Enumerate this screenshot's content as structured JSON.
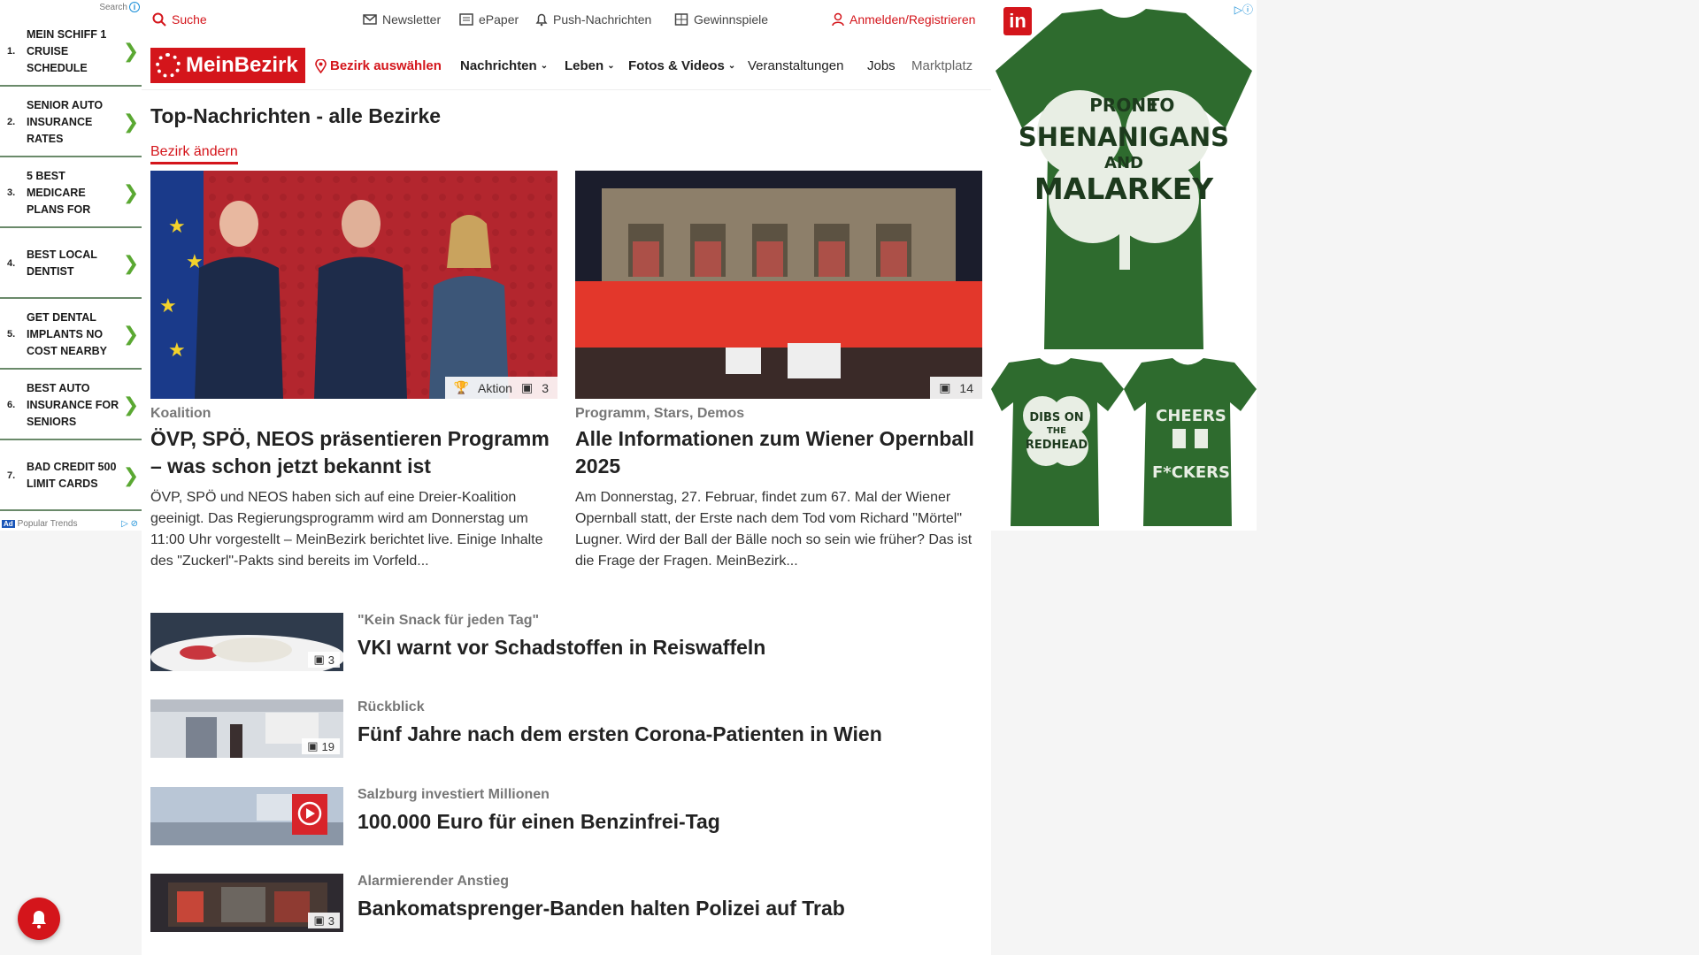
{
  "left_ad": {
    "search_label": "Search",
    "items": [
      {
        "num": "1.",
        "text": "MEIN SCHIFF 1 CRUISE SCHEDULE"
      },
      {
        "num": "2.",
        "text": "SENIOR AUTO INSURANCE RATES"
      },
      {
        "num": "3.",
        "text": "5 BEST MEDICARE PLANS FOR"
      },
      {
        "num": "4.",
        "text": "BEST LOCAL DENTIST"
      },
      {
        "num": "5.",
        "text": "GET DENTAL IMPLANTS NO COST NEARBY"
      },
      {
        "num": "6.",
        "text": "BEST AUTO INSURANCE FOR SENIORS"
      },
      {
        "num": "7.",
        "text": "BAD CREDIT 500 LIMIT CARDS"
      }
    ],
    "footer": "Popular Trends",
    "badge": "Ad"
  },
  "topbar": {
    "search": "Suche",
    "newsletter": "Newsletter",
    "epaper": "ePaper",
    "push": "Push-Nachrichten",
    "gewinnspiele": "Gewinnspiele",
    "login": "Anmelden/Registrieren"
  },
  "nav": {
    "logo": "MeinBezirk",
    "bezirk": "Bezirk auswählen",
    "items": [
      "Nachrichten",
      "Leben",
      "Fotos & Videos",
      "Veranstaltungen",
      "Jobs",
      "Marktplatz"
    ]
  },
  "page": {
    "title": "Top-Nachrichten - alle Bezirke",
    "change_link": "Bezirk ändern"
  },
  "cards": [
    {
      "kicker": "Koalition",
      "title": "ÖVP, SPÖ, NEOS präsentieren Programm – was schon jetzt bekannt ist",
      "teaser": "ÖVP, SPÖ und NEOS haben sich auf eine Dreier-Koalition geeinigt. Das Regierungsprogramm wird am Donnerstag um 11:00 Uhr vorgestellt – MeinBezirk berichtet live. Einige Inhalte des \"Zuckerl\"-Pakts sind bereits im Vorfeld...",
      "action_label": "Aktion",
      "photo_count": "3"
    },
    {
      "kicker": "Programm, Stars, Demos",
      "title": "Alle Informationen zum Wiener Opernball 2025",
      "teaser": "Am Donnerstag, 27. Februar, findet zum 67. Mal der Wiener Opernball statt, der Erste nach dem Tod vom Richard \"Mörtel\" Lugner. Wird der Ball der Bälle noch so sein wie früher? Das ist die Frage der Fragen. MeinBezirk...",
      "photo_count": "14"
    }
  ],
  "list": [
    {
      "kicker": "\"Kein Snack für jeden Tag\"",
      "title": "VKI warnt vor Schadstoffen in Reiswaffeln",
      "count": "3"
    },
    {
      "kicker": "Rückblick",
      "title": "Fünf Jahre nach dem ersten Corona-Patienten in Wien",
      "count": "19"
    },
    {
      "kicker": "Salzburg investiert Millionen",
      "title": "100.000 Euro für einen Benzinfrei-Tag",
      "count": ""
    },
    {
      "kicker": "Alarmierender Anstieg",
      "title": "Bankomatsprenger-Banden halten Polizei auf Trab",
      "count": "3"
    }
  ],
  "right_ad": {
    "brand": "in",
    "shirt1_lines": [
      "PRONE",
      "TO",
      "SHENANIGANS",
      "AND",
      "MALARKEY"
    ],
    "shirt2_lines": [
      "DIBS ON",
      "THE",
      "REDHEAD"
    ],
    "shirt3_lines": [
      "CHEERS",
      "F*CKERS"
    ]
  },
  "colors": {
    "brand_red": "#d4151b",
    "shirt_green": "#2e6b2e"
  }
}
